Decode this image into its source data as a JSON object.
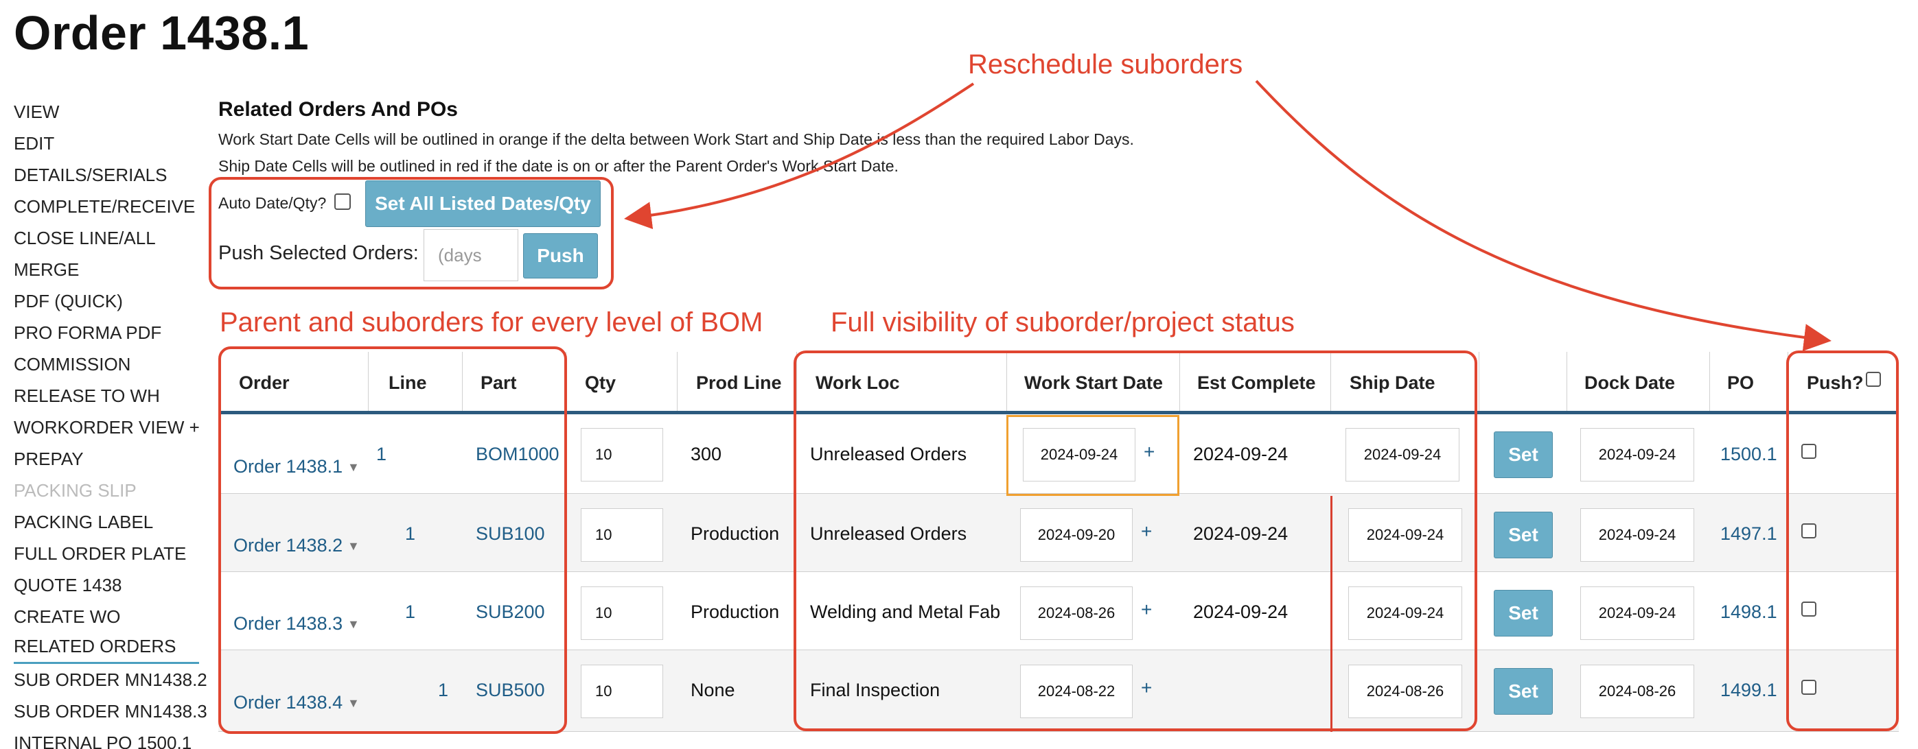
{
  "page": {
    "title": "Order 1438.1"
  },
  "sidebar": {
    "items": [
      {
        "label": "VIEW"
      },
      {
        "label": "EDIT"
      },
      {
        "label": "DETAILS/SERIALS"
      },
      {
        "label": "COMPLETE/RECEIVE"
      },
      {
        "label": "CLOSE LINE/ALL"
      },
      {
        "label": "MERGE"
      },
      {
        "label": "PDF (QUICK)"
      },
      {
        "label": "PRO FORMA PDF"
      },
      {
        "label": "COMMISSION"
      },
      {
        "label": "RELEASE TO WH"
      },
      {
        "label": "WORKORDER VIEW +"
      },
      {
        "label": "PREPAY"
      },
      {
        "label": "PACKING SLIP",
        "state": "disabled"
      },
      {
        "label": "PACKING LABEL"
      },
      {
        "label": "FULL ORDER PLATE"
      },
      {
        "label": "QUOTE 1438"
      },
      {
        "label": "CREATE WO"
      },
      {
        "label": "RELATED ORDERS",
        "state": "active"
      },
      {
        "label": "SUB ORDER MN1438.2"
      },
      {
        "label": "SUB ORDER MN1438.3"
      },
      {
        "label": "INTERNAL PO 1500.1"
      }
    ]
  },
  "related": {
    "title": "Related Orders And POs",
    "help1": "Work Start Date Cells will be outlined in orange if the delta between Work Start and Ship Date is less than the required Labor Days.",
    "help2": "Ship Date Cells will be outlined in red if the date is on or after the Parent Order's Work Start Date.",
    "auto_label": "Auto Date/Qty?",
    "set_all_label": "Set All Listed Dates/Qty",
    "push_label": "Push Selected Orders:",
    "days_placeholder": "(days",
    "push_button": "Push"
  },
  "annotations": {
    "reschedule": "Reschedule suborders",
    "parent": "Parent and suborders for every level of BOM",
    "visibility": "Full visibility of suborder/project status"
  },
  "table": {
    "headers": {
      "order": "Order",
      "line": "Line",
      "part": "Part",
      "qty": "Qty",
      "prod_line": "Prod Line",
      "work_loc": "Work Loc",
      "work_start": "Work Start Date",
      "est_complete": "Est Complete",
      "ship_date": "Ship Date",
      "dock_date": "Dock Date",
      "po": "PO",
      "push": "Push?"
    },
    "set_label": "Set",
    "plus": "+",
    "rows": [
      {
        "order": "Order 1438.1",
        "line": "1",
        "part": "BOM1000",
        "qty": "10",
        "prod_line": "300",
        "work_loc": "Unreleased Orders",
        "work_start": "2024-09-24",
        "est_complete": "2024-09-24",
        "ship_date": "2024-09-24",
        "dock_date": "2024-09-24",
        "po": "1500.1"
      },
      {
        "order": "Order 1438.2",
        "line": "1",
        "part": "SUB100",
        "qty": "10",
        "prod_line": "Production",
        "work_loc": "Unreleased Orders",
        "work_start": "2024-09-20",
        "est_complete": "2024-09-24",
        "ship_date": "2024-09-24",
        "dock_date": "2024-09-24",
        "po": "1497.1"
      },
      {
        "order": "Order 1438.3",
        "line": "1",
        "part": "SUB200",
        "qty": "10",
        "prod_line": "Production",
        "work_loc": "Welding and Metal Fab",
        "work_start": "2024-08-26",
        "est_complete": "2024-09-24",
        "ship_date": "2024-09-24",
        "dock_date": "2024-09-24",
        "po": "1498.1"
      },
      {
        "order": "Order 1438.4",
        "line": "1",
        "part": "SUB500",
        "qty": "10",
        "prod_line": "None",
        "work_loc": "Final Inspection",
        "work_start": "2024-08-22",
        "est_complete": "",
        "ship_date": "2024-08-26",
        "dock_date": "2024-08-26",
        "po": "1499.1"
      }
    ]
  },
  "colors": {
    "accent": "#6aaec8",
    "link": "#1f5d87",
    "annotation_red": "#e04530",
    "warning_orange": "#f0a030",
    "header_rule": "#2c5a7e"
  }
}
